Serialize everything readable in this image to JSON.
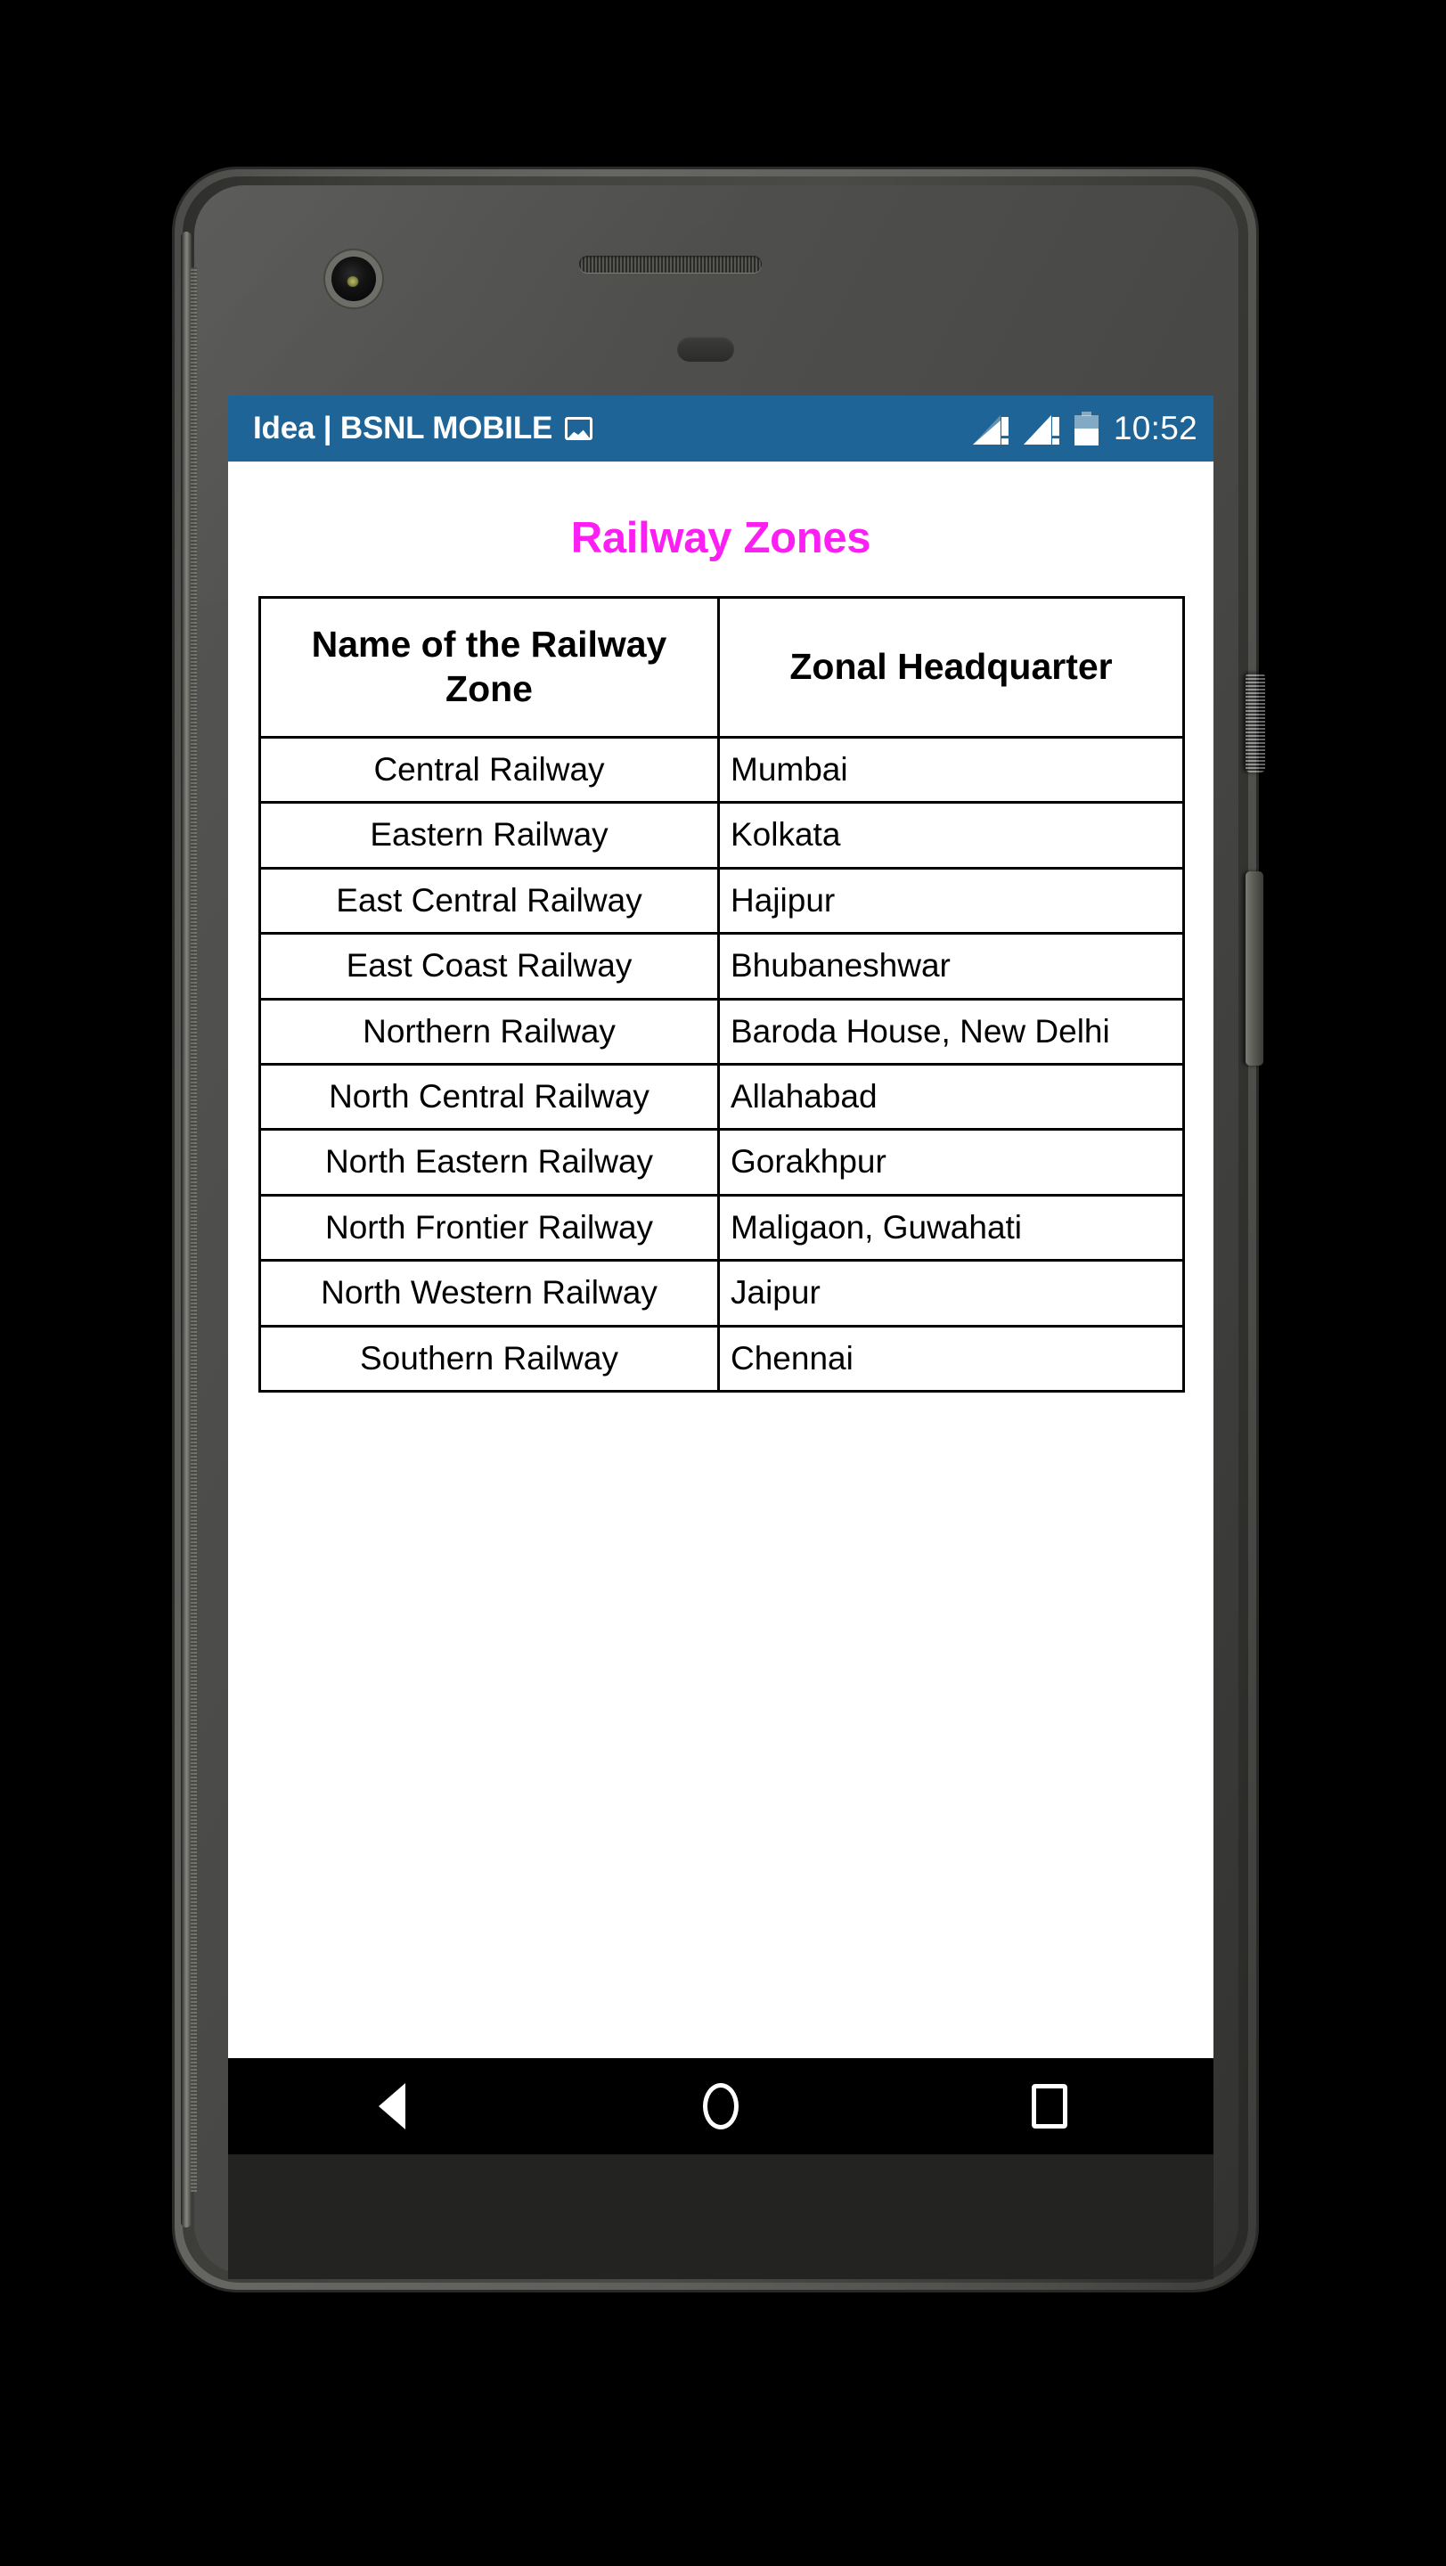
{
  "status_bar": {
    "carrier": "Idea | BSNL MOBILE",
    "image_icon": "image-icon",
    "signal_1_icon": "signal-alert-icon",
    "signal_2_icon": "signal-alert-icon",
    "battery_icon": "battery-half-icon",
    "time": "10:52",
    "background_color": "#1e6496",
    "text_color": "#ffffff"
  },
  "app": {
    "title": "Railway Zones",
    "title_color": "#fb1ff3",
    "background_color": "#ffffff"
  },
  "table": {
    "columns": [
      "Name of the Railway Zone",
      "Zonal Headquarter"
    ],
    "rows": [
      {
        "zone": "Central Railway",
        "hq": "Mumbai"
      },
      {
        "zone": "Eastern Railway",
        "hq": "Kolkata"
      },
      {
        "zone": "East Central Railway",
        "hq": "Hajipur"
      },
      {
        "zone": "East Coast Railway",
        "hq": "Bhubaneshwar"
      },
      {
        "zone": "Northern Railway",
        "hq": "Baroda House, New Delhi"
      },
      {
        "zone": "North Central Railway",
        "hq": "Allahabad"
      },
      {
        "zone": "North Eastern Railway",
        "hq": "Gorakhpur"
      },
      {
        "zone": "North Frontier Railway",
        "hq": "Maligaon, Guwahati"
      },
      {
        "zone": "North Western Railway",
        "hq": "Jaipur"
      },
      {
        "zone": "Southern Railway",
        "hq": "Chennai"
      }
    ]
  },
  "nav_bar": {
    "back_icon": "back-triangle-icon",
    "home_icon": "home-circle-icon",
    "recents_icon": "recents-square-icon",
    "background_color": "#000000"
  },
  "device": {
    "front_camera": "front-camera",
    "earpiece": "earpiece-speaker",
    "power_button": "power-button",
    "volume_button": "volume-button"
  }
}
